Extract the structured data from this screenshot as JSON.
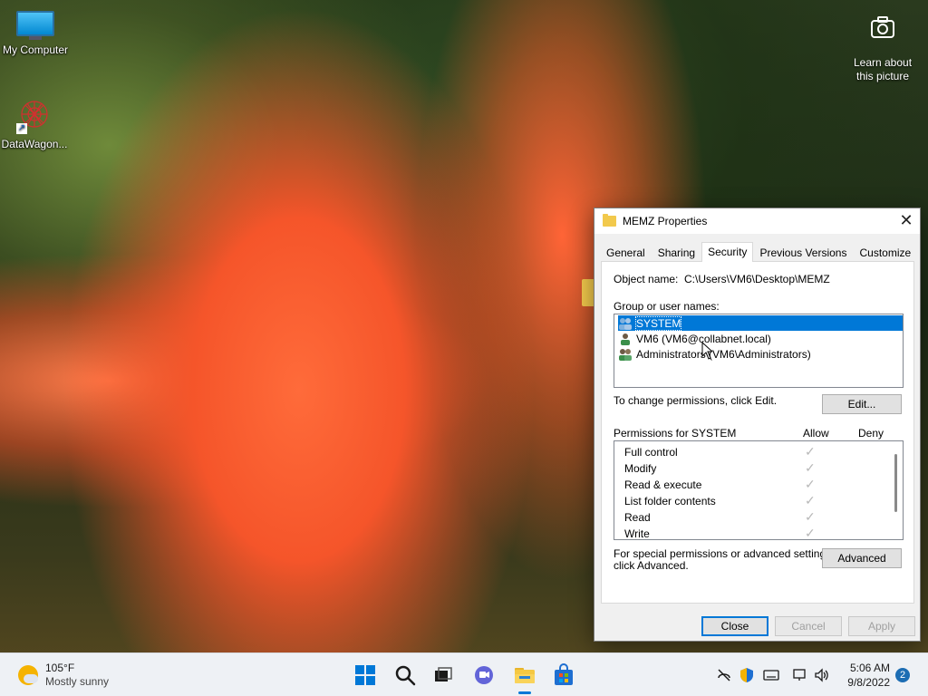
{
  "desktop": {
    "icons": [
      {
        "label": "My Computer"
      },
      {
        "label": "DataWagon..."
      }
    ],
    "learn_label_1": "Learn about",
    "learn_label_2": "this picture"
  },
  "dialog": {
    "title": "MEMZ Properties",
    "close_glyph": "✕",
    "tabs": [
      "General",
      "Sharing",
      "Security",
      "Previous Versions",
      "Customize"
    ],
    "active_tab": "Security",
    "object_name_label": "Object name:",
    "object_name_value": "C:\\Users\\VM6\\Desktop\\MEMZ",
    "group_label": "Group or user names:",
    "users": [
      {
        "name": "SYSTEM",
        "selected": true
      },
      {
        "name": "VM6 (VM6@collabnet.local)",
        "selected": false
      },
      {
        "name": "Administrators (VM6\\Administrators)",
        "selected": false
      }
    ],
    "change_text": "To change permissions, click Edit.",
    "edit_button": "Edit...",
    "perm_label": "Permissions for SYSTEM",
    "allow_header": "Allow",
    "deny_header": "Deny",
    "permissions": [
      {
        "name": "Full control",
        "allow": true,
        "deny": false
      },
      {
        "name": "Modify",
        "allow": true,
        "deny": false
      },
      {
        "name": "Read & execute",
        "allow": true,
        "deny": false
      },
      {
        "name": "List folder contents",
        "allow": true,
        "deny": false
      },
      {
        "name": "Read",
        "allow": true,
        "deny": false
      },
      {
        "name": "Write",
        "allow": true,
        "deny": false
      }
    ],
    "check_glyph": "✓",
    "special_text_1": "For special permissions or advanced settings,",
    "special_text_2": "click Advanced.",
    "advanced_button": "Advanced",
    "close_button": "Close",
    "cancel_button": "Cancel",
    "apply_button": "Apply"
  },
  "taskbar": {
    "weather_temp": "105°F",
    "weather_desc": "Mostly sunny",
    "time": "5:06 AM",
    "date": "9/8/2022",
    "notifications": "2",
    "pinned": [
      "windows-start-icon",
      "search-icon",
      "task-view-icon",
      "chat-icon",
      "file-explorer-icon",
      "store-icon"
    ],
    "accent": "#0078d7"
  }
}
